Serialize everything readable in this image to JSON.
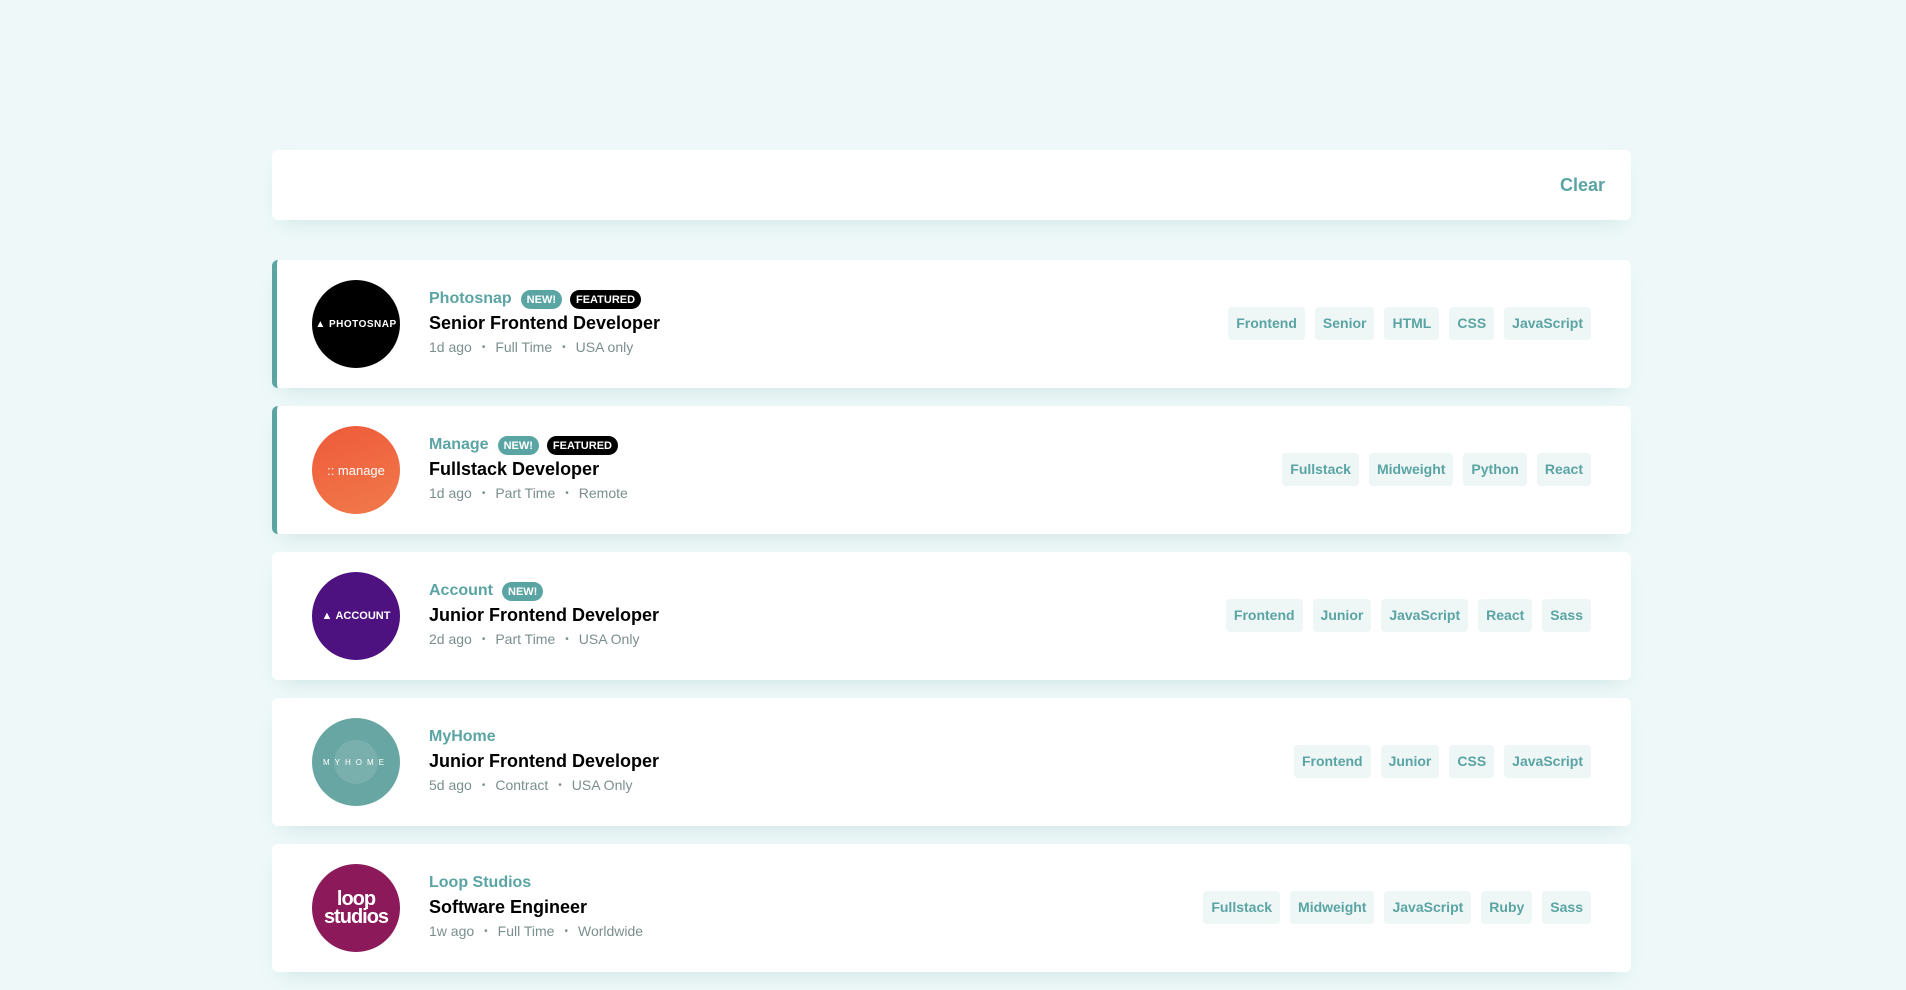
{
  "filter_bar": {
    "clear_label": "Clear"
  },
  "jobs": [
    {
      "company": "Photosnap",
      "logo_text": "PHOTOSNAP",
      "logo_icon": "photosnap-logo-icon",
      "new_label": "NEW!",
      "featured_label": "FEATURED",
      "position": "Senior Frontend Developer",
      "posted": "1d ago",
      "contract": "Full Time",
      "location": "USA only",
      "tags": [
        "Frontend",
        "Senior",
        "HTML",
        "CSS",
        "JavaScript"
      ]
    },
    {
      "company": "Manage",
      "logo_text": ":: manage",
      "logo_icon": "manage-logo-icon",
      "new_label": "NEW!",
      "featured_label": "FEATURED",
      "position": "Fullstack Developer",
      "posted": "1d ago",
      "contract": "Part Time",
      "location": "Remote",
      "tags": [
        "Fullstack",
        "Midweight",
        "Python",
        "React"
      ]
    },
    {
      "company": "Account",
      "logo_text": "ACCOUNT",
      "logo_icon": "account-logo-icon",
      "new_label": "NEW!",
      "position": "Junior Frontend Developer",
      "posted": "2d ago",
      "contract": "Part Time",
      "location": "USA Only",
      "tags": [
        "Frontend",
        "Junior",
        "JavaScript",
        "React",
        "Sass"
      ]
    },
    {
      "company": "MyHome",
      "logo_text": "MYHOME",
      "logo_icon": "myhome-logo-icon",
      "position": "Junior Frontend Developer",
      "posted": "5d ago",
      "contract": "Contract",
      "location": "USA Only",
      "tags": [
        "Frontend",
        "Junior",
        "CSS",
        "JavaScript"
      ]
    },
    {
      "company": "Loop Studios",
      "logo_text_line1": "loop",
      "logo_text_line2": "studios",
      "logo_icon": "loop-studios-logo-icon",
      "position": "Software Engineer",
      "posted": "1w ago",
      "contract": "Full Time",
      "location": "Worldwide",
      "tags": [
        "Fullstack",
        "Midweight",
        "JavaScript",
        "Ruby",
        "Sass"
      ]
    }
  ],
  "colors": {
    "background": "#eef8f8",
    "accent": "#5ba4a4",
    "featured_badge": "#000000",
    "tag_bg": "#eef6f6"
  }
}
